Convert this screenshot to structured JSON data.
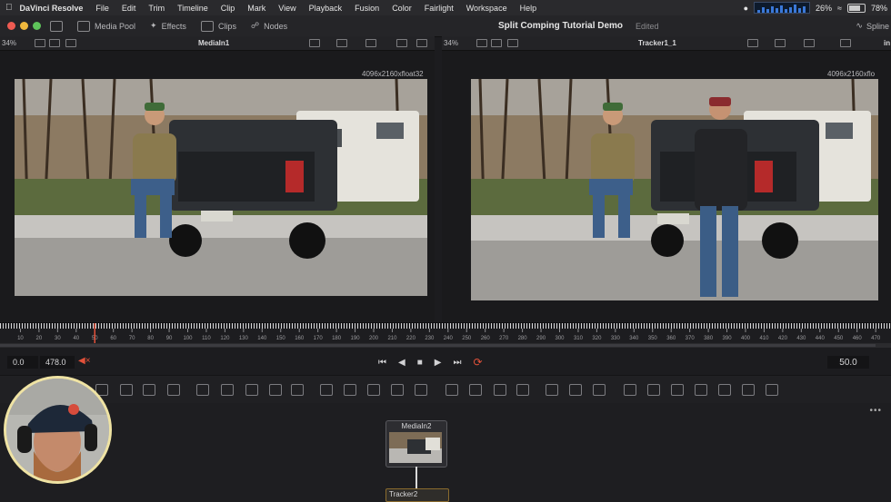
{
  "menubar": {
    "app_name": "DaVinci Resolve",
    "items": [
      "File",
      "Edit",
      "Trim",
      "Timeline",
      "Clip",
      "Mark",
      "View",
      "Playback",
      "Fusion",
      "Color",
      "Fairlight",
      "Workspace",
      "Help"
    ],
    "cpu_percent": "26%",
    "battery_percent": "78%"
  },
  "toolbar": {
    "media_pool": "Media Pool",
    "effects": "Effects",
    "clips": "Clips",
    "nodes": "Nodes",
    "project_title": "Split Comping Tutorial Demo",
    "project_status": "Edited",
    "spline": "Spline"
  },
  "viewer_left": {
    "zoom": "34%",
    "title": "MediaIn1",
    "resolution": "4096x2160xfloat32"
  },
  "viewer_right": {
    "zoom": "34%",
    "title": "Tracker1_1",
    "resolution": "4096x2160xflo",
    "side_label": "in"
  },
  "ruler": {
    "labels": [
      "10",
      "20",
      "30",
      "40",
      "50",
      "60",
      "70",
      "80",
      "90",
      "100",
      "110",
      "120",
      "130",
      "140",
      "150",
      "160",
      "170",
      "180",
      "190",
      "200",
      "210",
      "220",
      "230",
      "240",
      "250",
      "260",
      "270",
      "280",
      "290",
      "300",
      "310",
      "320",
      "330",
      "340",
      "350",
      "360",
      "370",
      "380",
      "390",
      "400",
      "410",
      "420",
      "430",
      "440",
      "450",
      "460",
      "470"
    ],
    "playhead_frame": 50
  },
  "transport": {
    "start": "0.0",
    "end": "478.0",
    "current": "50.0"
  },
  "nodes": {
    "node1": "MediaIn2",
    "node2": "Tracker2"
  },
  "colors": {
    "accent_loop": "#e2513a",
    "playhead": "#e2513a",
    "webcam_ring": "#efe3a3"
  },
  "icons": [
    "apple-icon",
    "effects-icon",
    "clips-icon",
    "nodes-icon",
    "play-icon",
    "stop-icon",
    "loop-icon",
    "mute-icon"
  ]
}
